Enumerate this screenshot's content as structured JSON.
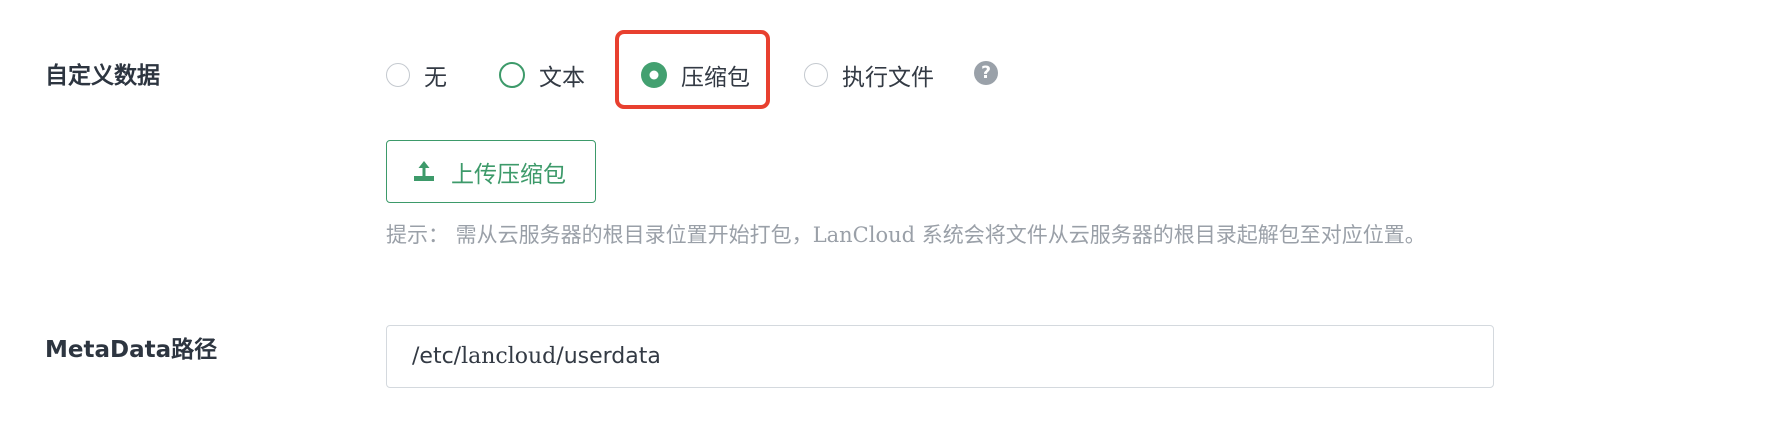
{
  "form": {
    "userdata_label": "自定义数据",
    "metadata_label": "MetaData路径"
  },
  "userdata_type": {
    "options": [
      {
        "label": "无",
        "state": "unchecked"
      },
      {
        "label": "文本",
        "state": "hover"
      },
      {
        "label": "压缩包",
        "state": "checked"
      },
      {
        "label": "执行文件",
        "state": "unchecked"
      }
    ],
    "selected": "压缩包",
    "help_icon": "question-circle-icon",
    "help_glyph": "?"
  },
  "upload": {
    "label": "上传压缩包",
    "icon": "upload-icon"
  },
  "hint": {
    "prefix": "提示： 需从云服务器的根目录位置开始打包，",
    "brand": "LanCloud",
    "suffix": " 系统会将文件从云服务器的根目录起解包至对应位置。"
  },
  "metadata_path": {
    "part1": "/etc/",
    "part2": "lancloud",
    "part3": "/userdata"
  },
  "colors": {
    "accent": "#3d9a6a",
    "highlight": "#e8402f",
    "hint_text": "#9aa0a8",
    "label_text": "#2d3540"
  }
}
